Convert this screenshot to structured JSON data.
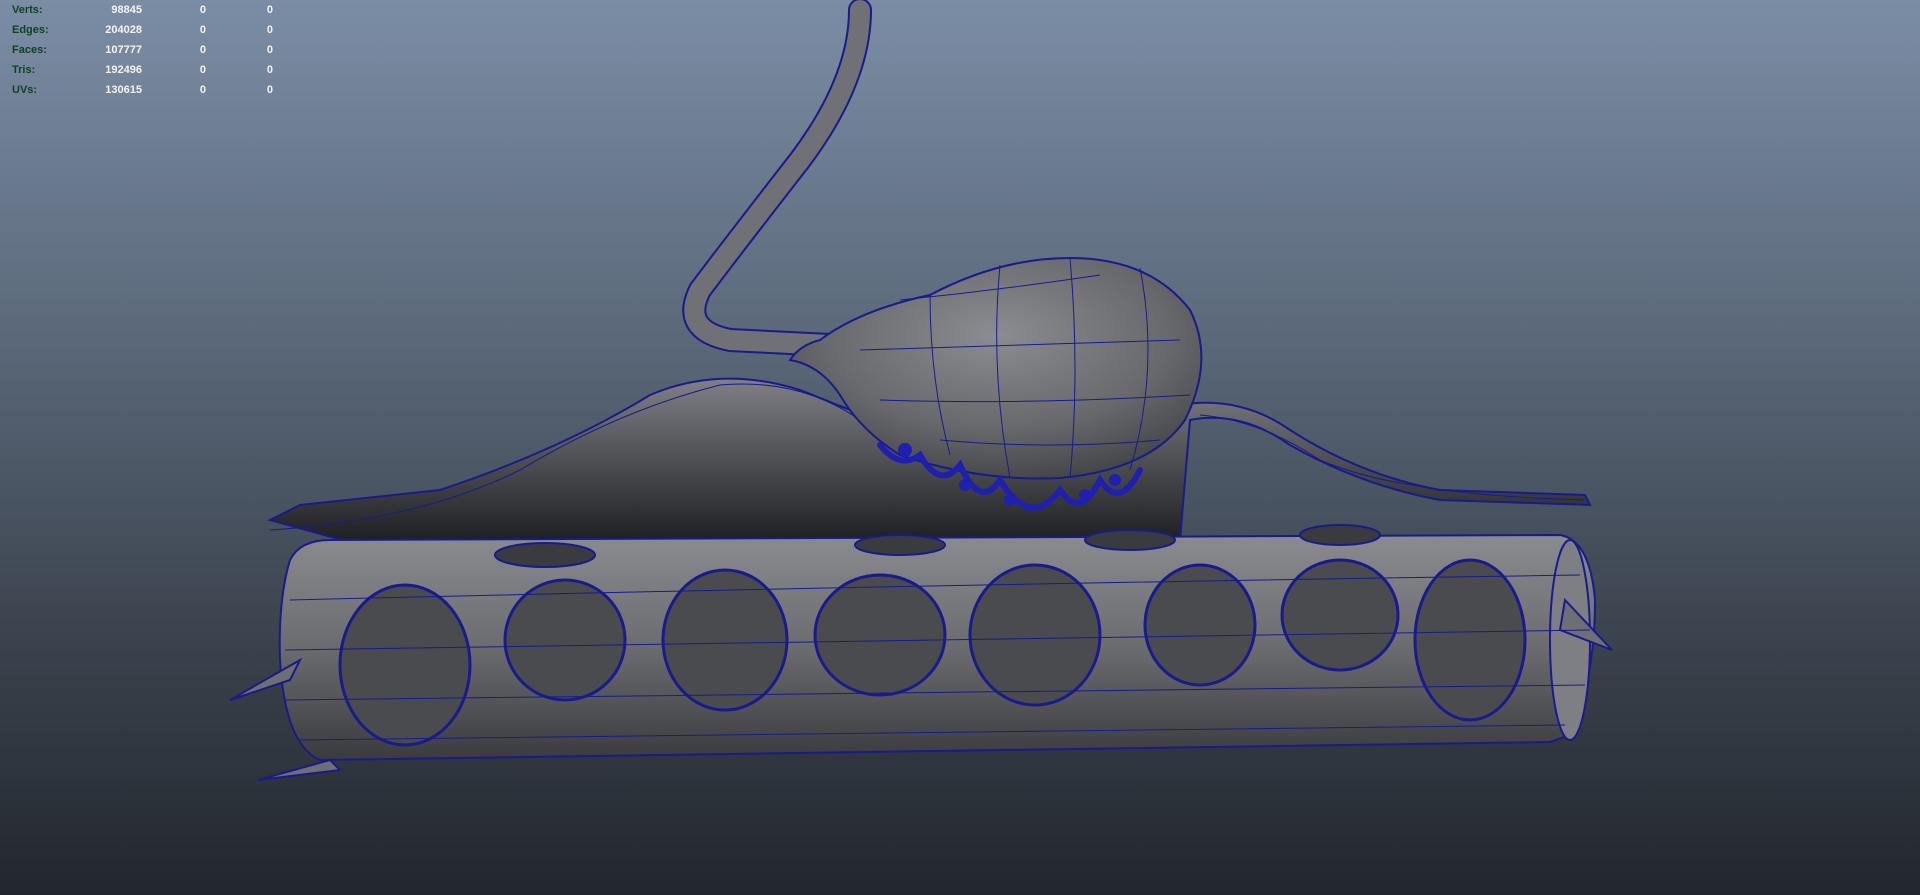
{
  "viewport": {
    "background_top": "#7b8da5",
    "background_bottom": "#22272d"
  },
  "heads_up_display": {
    "label_color": "#0f4226",
    "value_color": "#f4f4f4",
    "rows": [
      {
        "label": "Verts:",
        "values": [
          "98845",
          "0",
          "0"
        ]
      },
      {
        "label": "Edges:",
        "values": [
          "204028",
          "0",
          "0"
        ]
      },
      {
        "label": "Faces:",
        "values": [
          "107777",
          "0",
          "0"
        ]
      },
      {
        "label": "Tris:",
        "values": [
          "192496",
          "0",
          "0"
        ]
      },
      {
        "label": "UVs:",
        "values": [
          "130615",
          "0",
          "0"
        ]
      }
    ]
  },
  "scene": {
    "mesh_color": "#5a5a5e",
    "wireframe_color": "#1a1a8c",
    "selected_component_color": "#1f1fb0"
  }
}
